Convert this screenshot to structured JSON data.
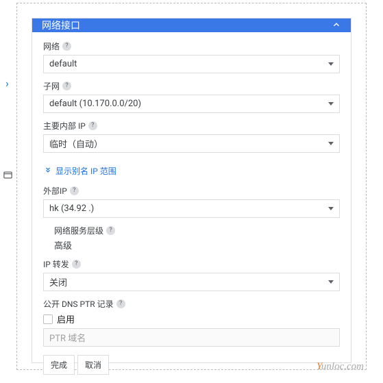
{
  "header": {
    "title": "网络接口"
  },
  "fields": {
    "network": {
      "label": "网络",
      "value": "default"
    },
    "subnet": {
      "label": "子网",
      "value": "default (10.170.0.0/20)"
    },
    "primaryInternalIp": {
      "label": "主要内部 IP",
      "value": "临时（自动）"
    },
    "aliasLink": "显示别名 IP 范围",
    "externalIp": {
      "label": "外部IP",
      "value": "hk (34.92        .)"
    },
    "networkTier": {
      "label": "网络服务层级",
      "value": "高级"
    },
    "ipForwarding": {
      "label": "IP 转发",
      "value": "关闭"
    },
    "dnsPtr": {
      "label": "公开 DNS PTR 记录",
      "checkboxLabel": "启用",
      "placeholder": "PTR 域名"
    }
  },
  "buttons": {
    "done": "完成",
    "cancel": "取消"
  },
  "watermark": {
    "first": "Y",
    "rest": "unloc.com"
  }
}
